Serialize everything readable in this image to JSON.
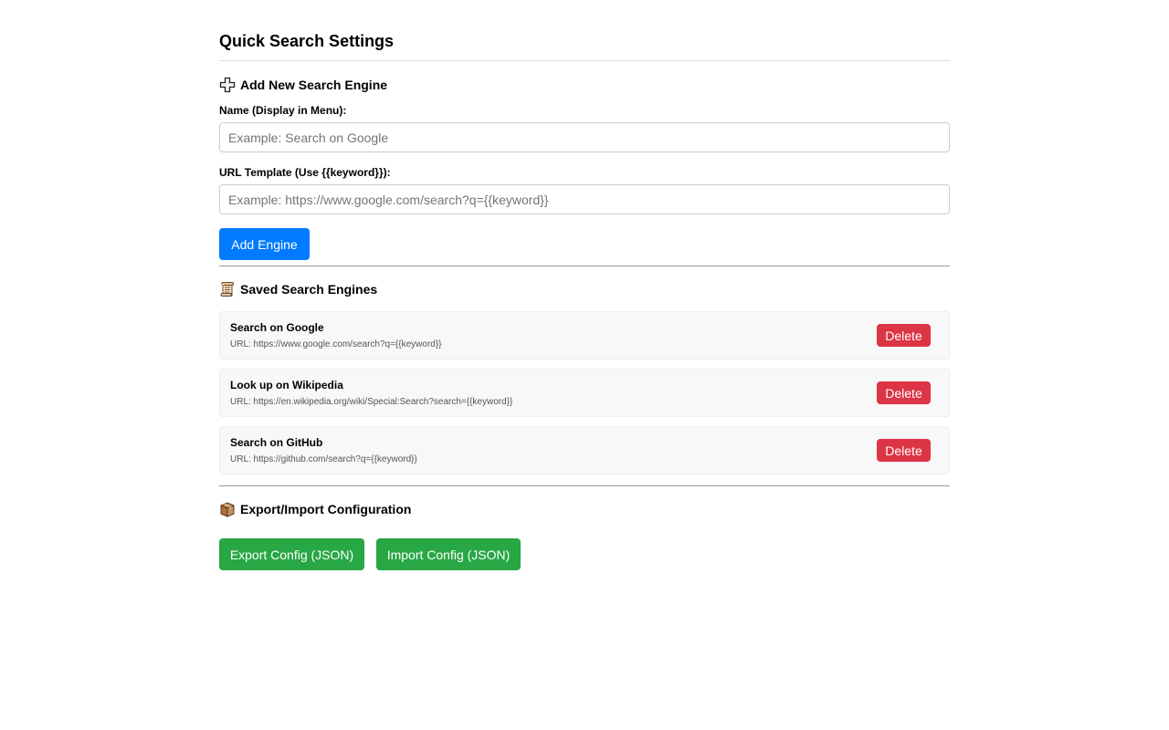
{
  "page": {
    "title": "Quick Search Settings"
  },
  "add_section": {
    "heading": "Add New Search Engine",
    "icon": "plus-icon",
    "name_label": "Name (Display in Menu):",
    "name_placeholder": "Example: Search on Google",
    "name_value": "",
    "url_label": "URL Template (Use {{keyword}}):",
    "url_placeholder": "Example: https://www.google.com/search?q={{keyword}}",
    "url_value": "",
    "add_button_label": "Add Engine"
  },
  "saved_section": {
    "heading": "Saved Search Engines",
    "icon": "scroll-icon",
    "engines": [
      {
        "name": "Search on Google",
        "url": "URL: https://www.google.com/search?q={{keyword}}",
        "delete_label": "Delete"
      },
      {
        "name": "Look up on Wikipedia",
        "url": "URL: https://en.wikipedia.org/wiki/Special:Search?search={{keyword}}",
        "delete_label": "Delete"
      },
      {
        "name": "Search on GitHub",
        "url": "URL: https://github.com/search?q={{keyword}}",
        "delete_label": "Delete"
      }
    ]
  },
  "config_section": {
    "heading": "Export/Import Configuration",
    "icon": "package-icon",
    "export_label": "Export Config (JSON)",
    "import_label": "Import Config (JSON)"
  },
  "colors": {
    "primary": "#007bff",
    "success": "#28a745",
    "danger": "#dc3545",
    "card_bg": "#f8f8f8"
  }
}
